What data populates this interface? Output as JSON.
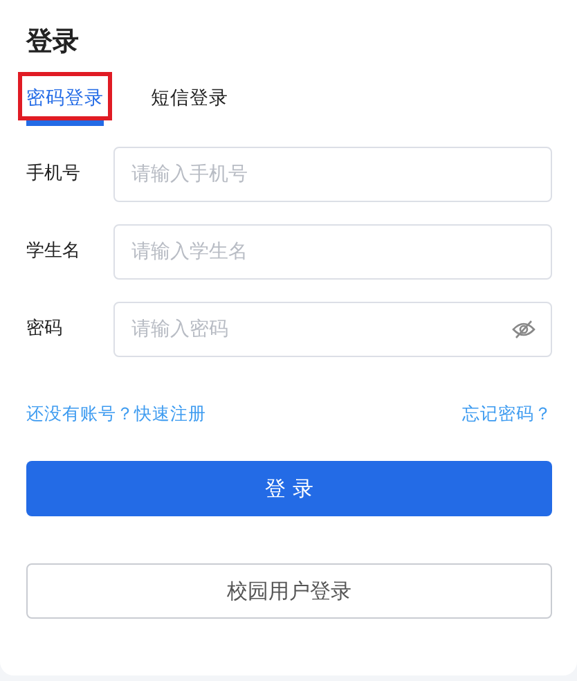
{
  "title": "登录",
  "tabs": [
    {
      "label": "密码登录",
      "selected": true,
      "highlighted": true
    },
    {
      "label": "短信登录",
      "selected": false,
      "highlighted": false
    }
  ],
  "fields": [
    {
      "label": "手机号",
      "placeholder": "请输入手机号",
      "kind": "text"
    },
    {
      "label": "学生名",
      "placeholder": "请输入学生名",
      "kind": "text"
    },
    {
      "label": "密码",
      "placeholder": "请输入密码",
      "kind": "password"
    }
  ],
  "links": {
    "register": "还没有账号？快速注册",
    "forgot": "忘记密码？"
  },
  "buttons": [
    {
      "label": "登 录",
      "kind": "primary"
    },
    {
      "label": "校园用户登录",
      "kind": "outline"
    }
  ]
}
